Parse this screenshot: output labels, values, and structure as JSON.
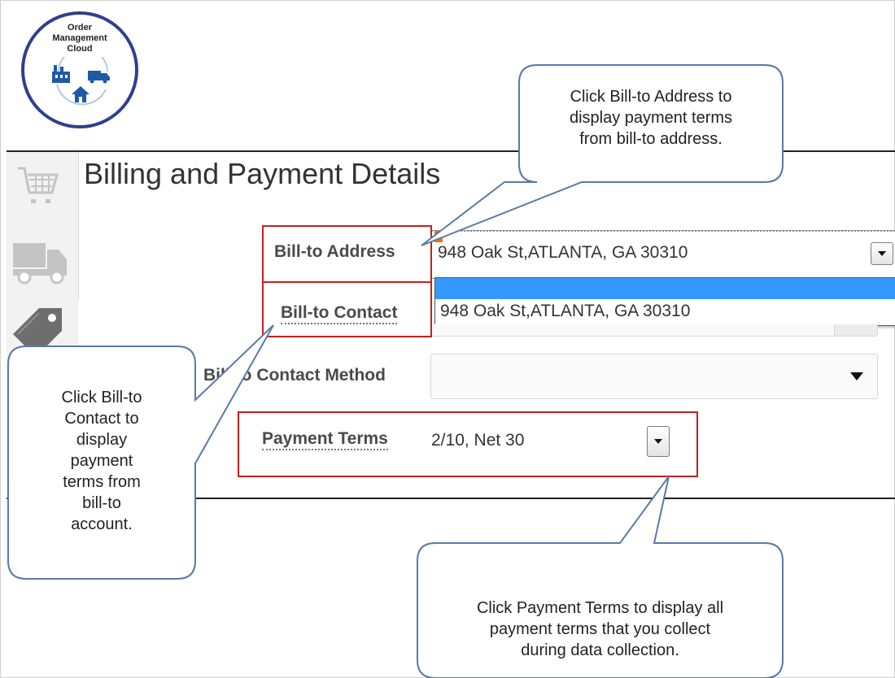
{
  "logo": {
    "lines": [
      "Order",
      "Management",
      "Cloud"
    ],
    "icon": "factory-truck-house-icon"
  },
  "sidebar": {
    "items": [
      {
        "icon": "shopping-cart-icon"
      },
      {
        "icon": "truck-icon"
      },
      {
        "icon": "price-tag-icon"
      }
    ]
  },
  "page": {
    "title": "Billing and Payment Details"
  },
  "form": {
    "bill_to_address": {
      "label": "Bill-to Address",
      "value": "948 Oak St,ATLANTA, GA 30310",
      "options": [
        "",
        "948 Oak St,ATLANTA, GA 30310"
      ]
    },
    "bill_to_contact": {
      "label": "Bill-to Contact"
    },
    "bill_to_contact_method": {
      "label": "Bill-to Contact Method"
    },
    "payment_terms": {
      "label": "Payment Terms",
      "value": "2/10, Net 30"
    }
  },
  "callouts": {
    "address": [
      "Click Bill-to Address to",
      "display payment terms",
      "from bill-to address."
    ],
    "contact": [
      "Click Bill-to",
      "Contact to",
      "display",
      "payment",
      "terms from",
      "bill-to",
      "account."
    ],
    "terms": [
      "Click Payment Terms to display all",
      "payment terms that you collect",
      "during data collection."
    ]
  },
  "colors": {
    "highlight_red": "#c81e1e",
    "selection_blue": "#3399ff",
    "callout_border": "#5b79a8"
  }
}
